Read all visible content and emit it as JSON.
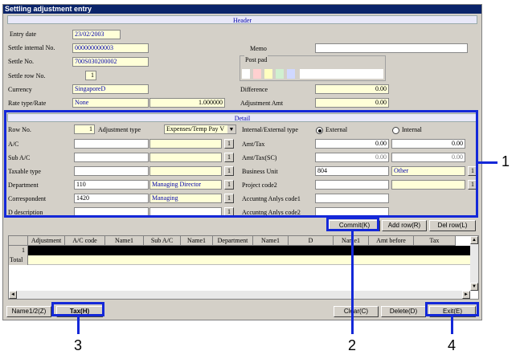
{
  "window": {
    "title": "Settling adjustment entry"
  },
  "header": {
    "section_label": "Header",
    "entry_date_label": "Entry date",
    "entry_date": "23/02/2003",
    "settle_internal_no_label": "Settle internal No.",
    "settle_internal_no": "000000000003",
    "settle_no_label": "Settle No.",
    "settle_no": "700S030200002",
    "settle_row_no_label": "Settle row No.",
    "settle_row_no": "1",
    "currency_label": "Currency",
    "currency": "SingaporeD",
    "rate_type_label": "Rate type/Rate",
    "rate_type": "None",
    "rate": "1.000000",
    "memo_label": "Memo",
    "memo": "",
    "post_pad_label": "Post pad",
    "difference_label": "Difference",
    "difference": "0.00",
    "adjustment_amt_label": "Adjustment Amt",
    "adjustment_amt": "0.00"
  },
  "colors": {
    "post_pad": [
      "#ffffff",
      "#ffd0d0",
      "#ffffc0",
      "#d0f0d0",
      "#d0d8ff"
    ],
    "highlight": "#1428d8"
  },
  "detail": {
    "section_label": "Detail",
    "row_no_label": "Row No.",
    "row_no": "1",
    "adjustment_type_label": "Adjustment type",
    "adjustment_type": "Expenses/Temp Pay V",
    "internal_external_label": "Internal/External type",
    "external_label": "External",
    "internal_label": "Internal",
    "ac_label": "A/C",
    "sub_ac_label": "Sub A/C",
    "taxable_type_label": "Taxable type",
    "department_label": "Department",
    "department_code": "110",
    "department_name": "Managing Director",
    "correspondent_label": "Correspondent",
    "correspondent_code": "1420",
    "correspondent_name": "Managing",
    "d_description_label": "D description",
    "amt_tax_label": "Amt/Tax",
    "amt": "0.00",
    "tax": "0.00",
    "amt_tax_sc_label": "Amt/Tax(SC)",
    "amt_sc": "0.00",
    "tax_sc": "0.00",
    "business_unit_label": "Business Unit",
    "business_unit_code": "804",
    "business_unit_name": "Other",
    "project_code2_label": "Project code2",
    "accounting_anlys_code1_label": "Accuntng Anlys code1",
    "accounting_anlys_code2_label": "Accuntng Anlys code2",
    "lookup_label": "1"
  },
  "actions": {
    "commit": "Commit(K)",
    "add_row": "Add row(R)",
    "del_row": "Del row(L)"
  },
  "grid": {
    "columns": [
      "Adjustment",
      "A/C code",
      "Name1",
      "Sub A/C",
      "Name1",
      "Department",
      "Name1",
      "D",
      "Name1",
      "Amt before",
      "Tax"
    ],
    "row_number": "1",
    "total_label": "Total"
  },
  "footer": {
    "name12": "Name1/2(Z)",
    "tax": "Tax(H)",
    "clear": "Clear(C)",
    "delete": "Delete(D)",
    "exit": "Exit(E)"
  },
  "callouts": [
    "1",
    "2",
    "3",
    "4"
  ],
  "glyphs": {
    "scroll_up": "▲",
    "scroll_down": "▼",
    "scroll_left": "◄",
    "scroll_right": "►",
    "dropdown": "▼"
  }
}
